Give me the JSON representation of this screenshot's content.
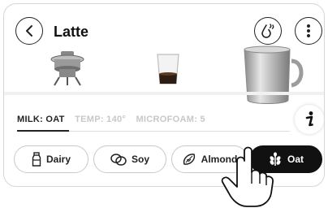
{
  "header": {
    "title": "Latte",
    "back_icon": "chevron-left-icon",
    "refill_icon": "water-drop-refill-icon",
    "menu_icon": "more-vertical-icon"
  },
  "products": [
    {
      "name": "espresso-machine",
      "icon": "espresso-machine-image"
    },
    {
      "name": "espresso-shot-glass",
      "icon": "shot-glass-image"
    },
    {
      "name": "milk-pitcher",
      "icon": "milk-pitcher-image"
    }
  ],
  "settings": {
    "milk": "MILK: OAT",
    "temp": "TEMP: 140°",
    "microfoam": "MICROFOAM: 5"
  },
  "info_icon": "info-icon",
  "milk_options": [
    {
      "label": "Dairy",
      "icon": "milk-bottle-icon",
      "selected": false
    },
    {
      "label": "Soy",
      "icon": "soybean-icon",
      "selected": false
    },
    {
      "label": "Almond",
      "icon": "almond-icon",
      "selected": false
    },
    {
      "label": "Oat",
      "icon": "oat-plant-icon",
      "selected": true
    }
  ],
  "colors": {
    "selected_bg": "#111111",
    "selected_text": "#ffffff",
    "inactive_tab": "#c8c8c8",
    "border": "#c9c9c9"
  },
  "gesture_hint": "tap-hand-icon"
}
